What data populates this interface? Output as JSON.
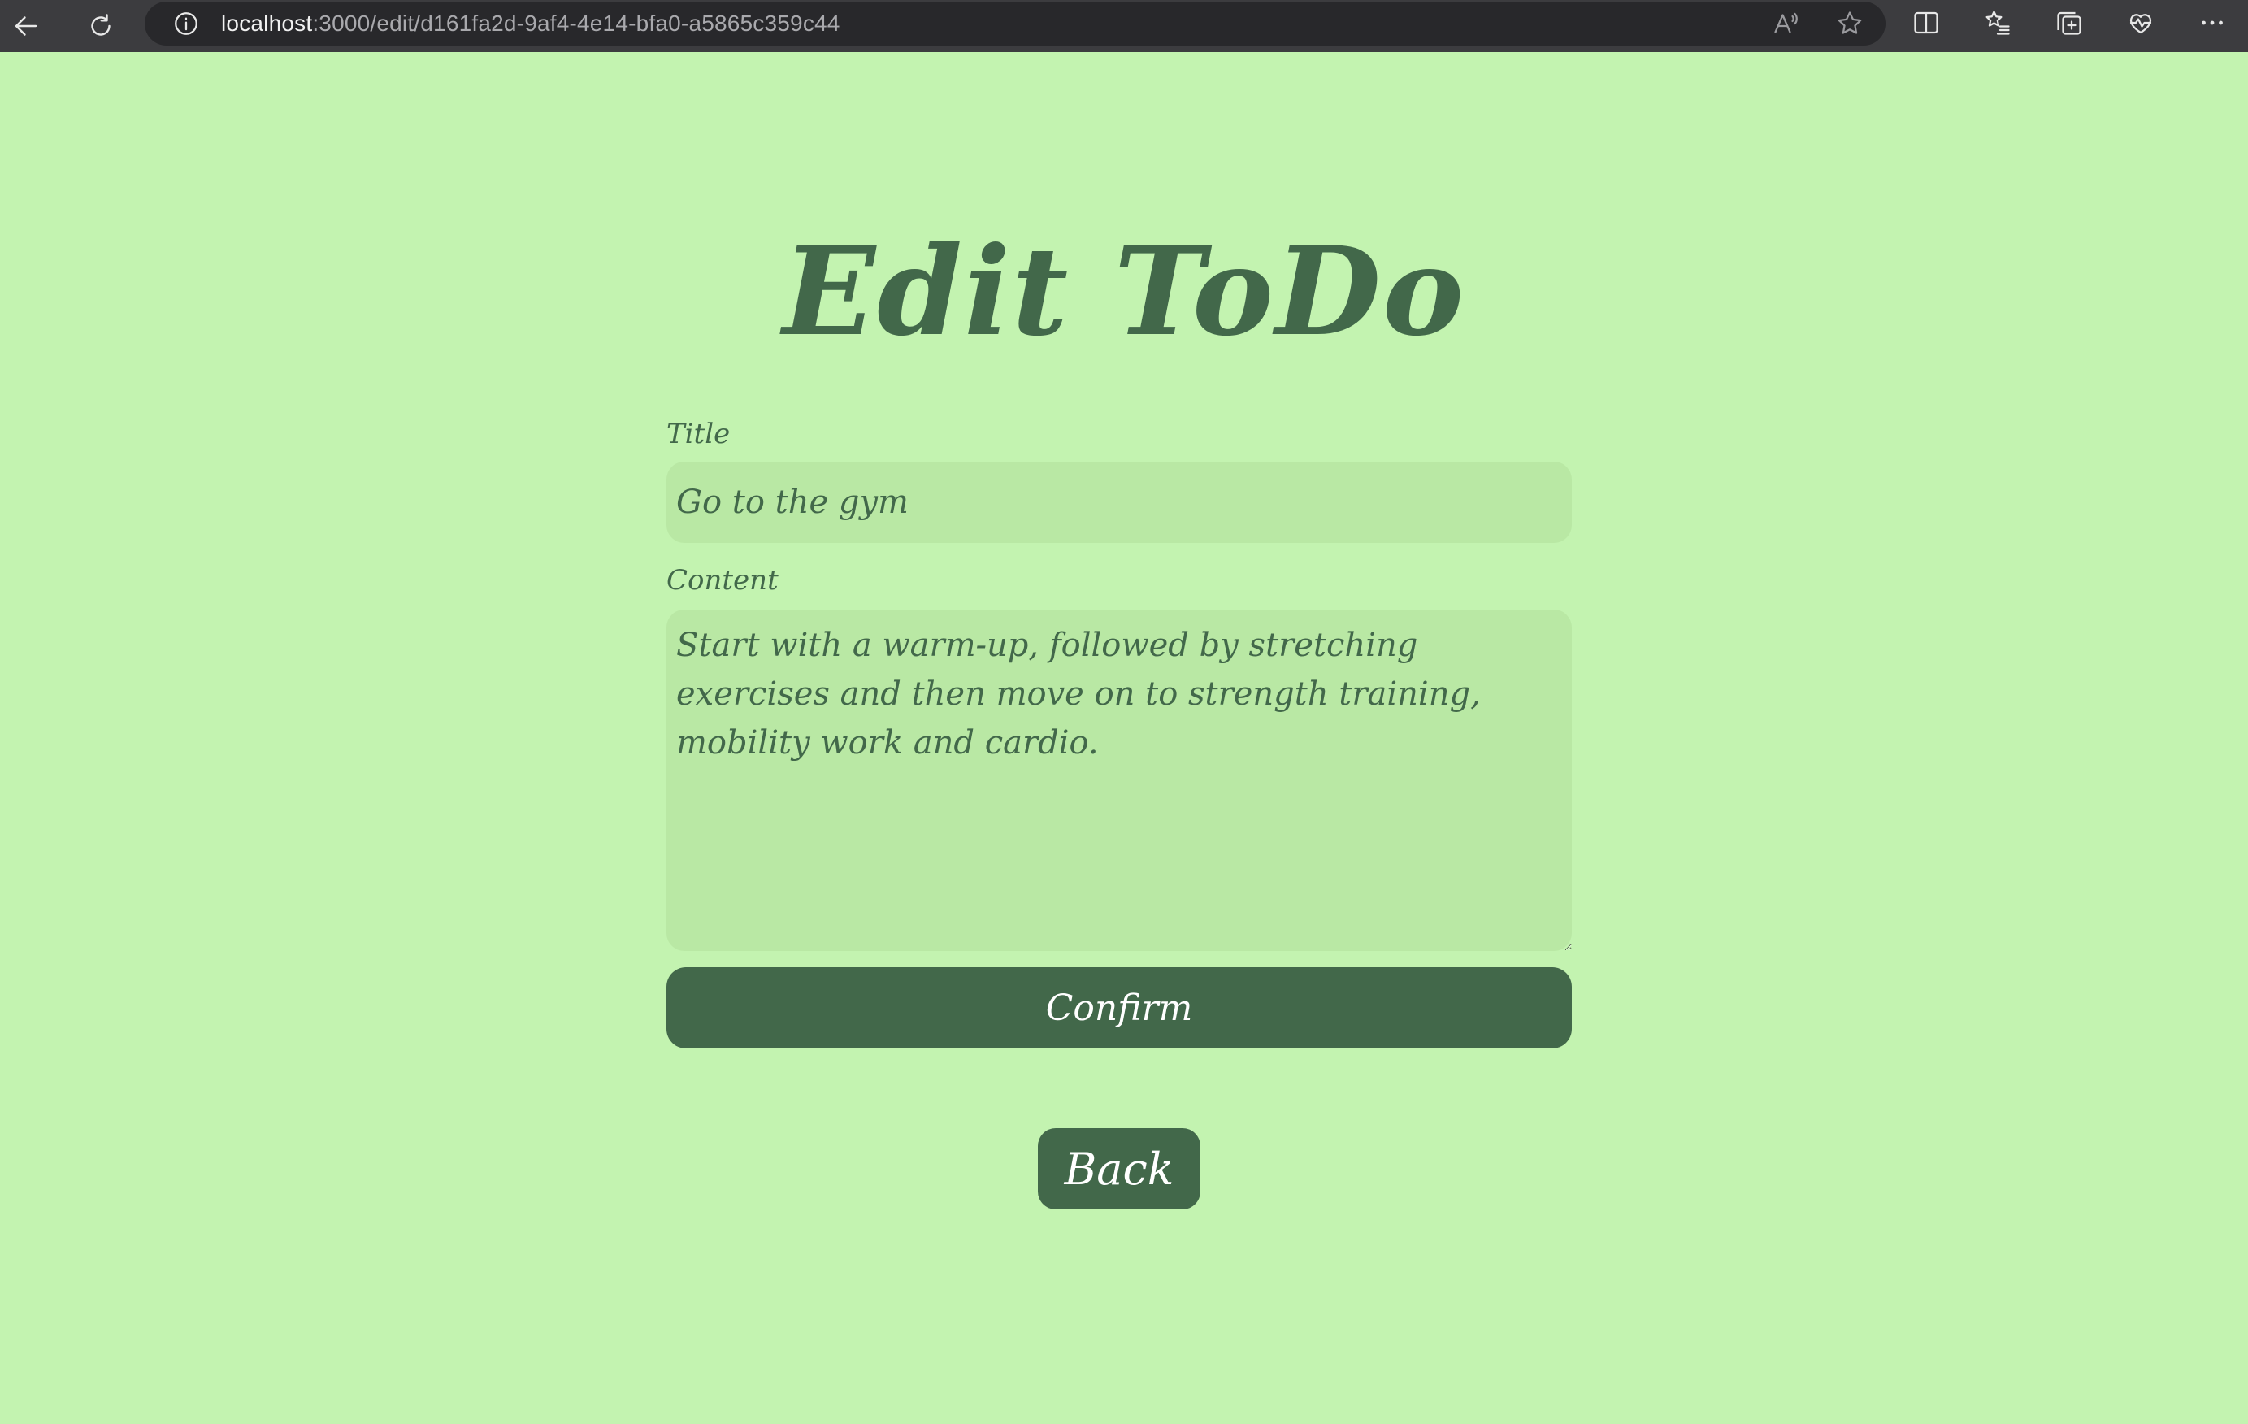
{
  "browser": {
    "url_host": "localhost",
    "url_path": ":3000/edit/d161fa2d-9af4-4e14-bfa0-a5865c359c44",
    "icons": [
      "back-arrow-icon",
      "refresh-icon",
      "info-icon",
      "read-aloud-icon",
      "favorite-star-icon",
      "split-screen-icon",
      "favorites-list-icon",
      "collections-icon",
      "browser-essentials-icon",
      "more-options-icon"
    ]
  },
  "page": {
    "title": "Edit ToDo",
    "form": {
      "title_label": "Title",
      "title_value": "Go to the gym",
      "content_label": "Content",
      "content_value": "Start with a warm-up, followed by stretching exercises and then move on to strength training, mobility work and cardio.",
      "confirm_label": "Confirm"
    },
    "back_label": "Back"
  },
  "colors": {
    "background": "#c3f3b0",
    "input_background": "#b9e8a4",
    "accent": "#42684a",
    "button_text": "#ffffff",
    "browser_chrome": "#3c3c3f"
  }
}
